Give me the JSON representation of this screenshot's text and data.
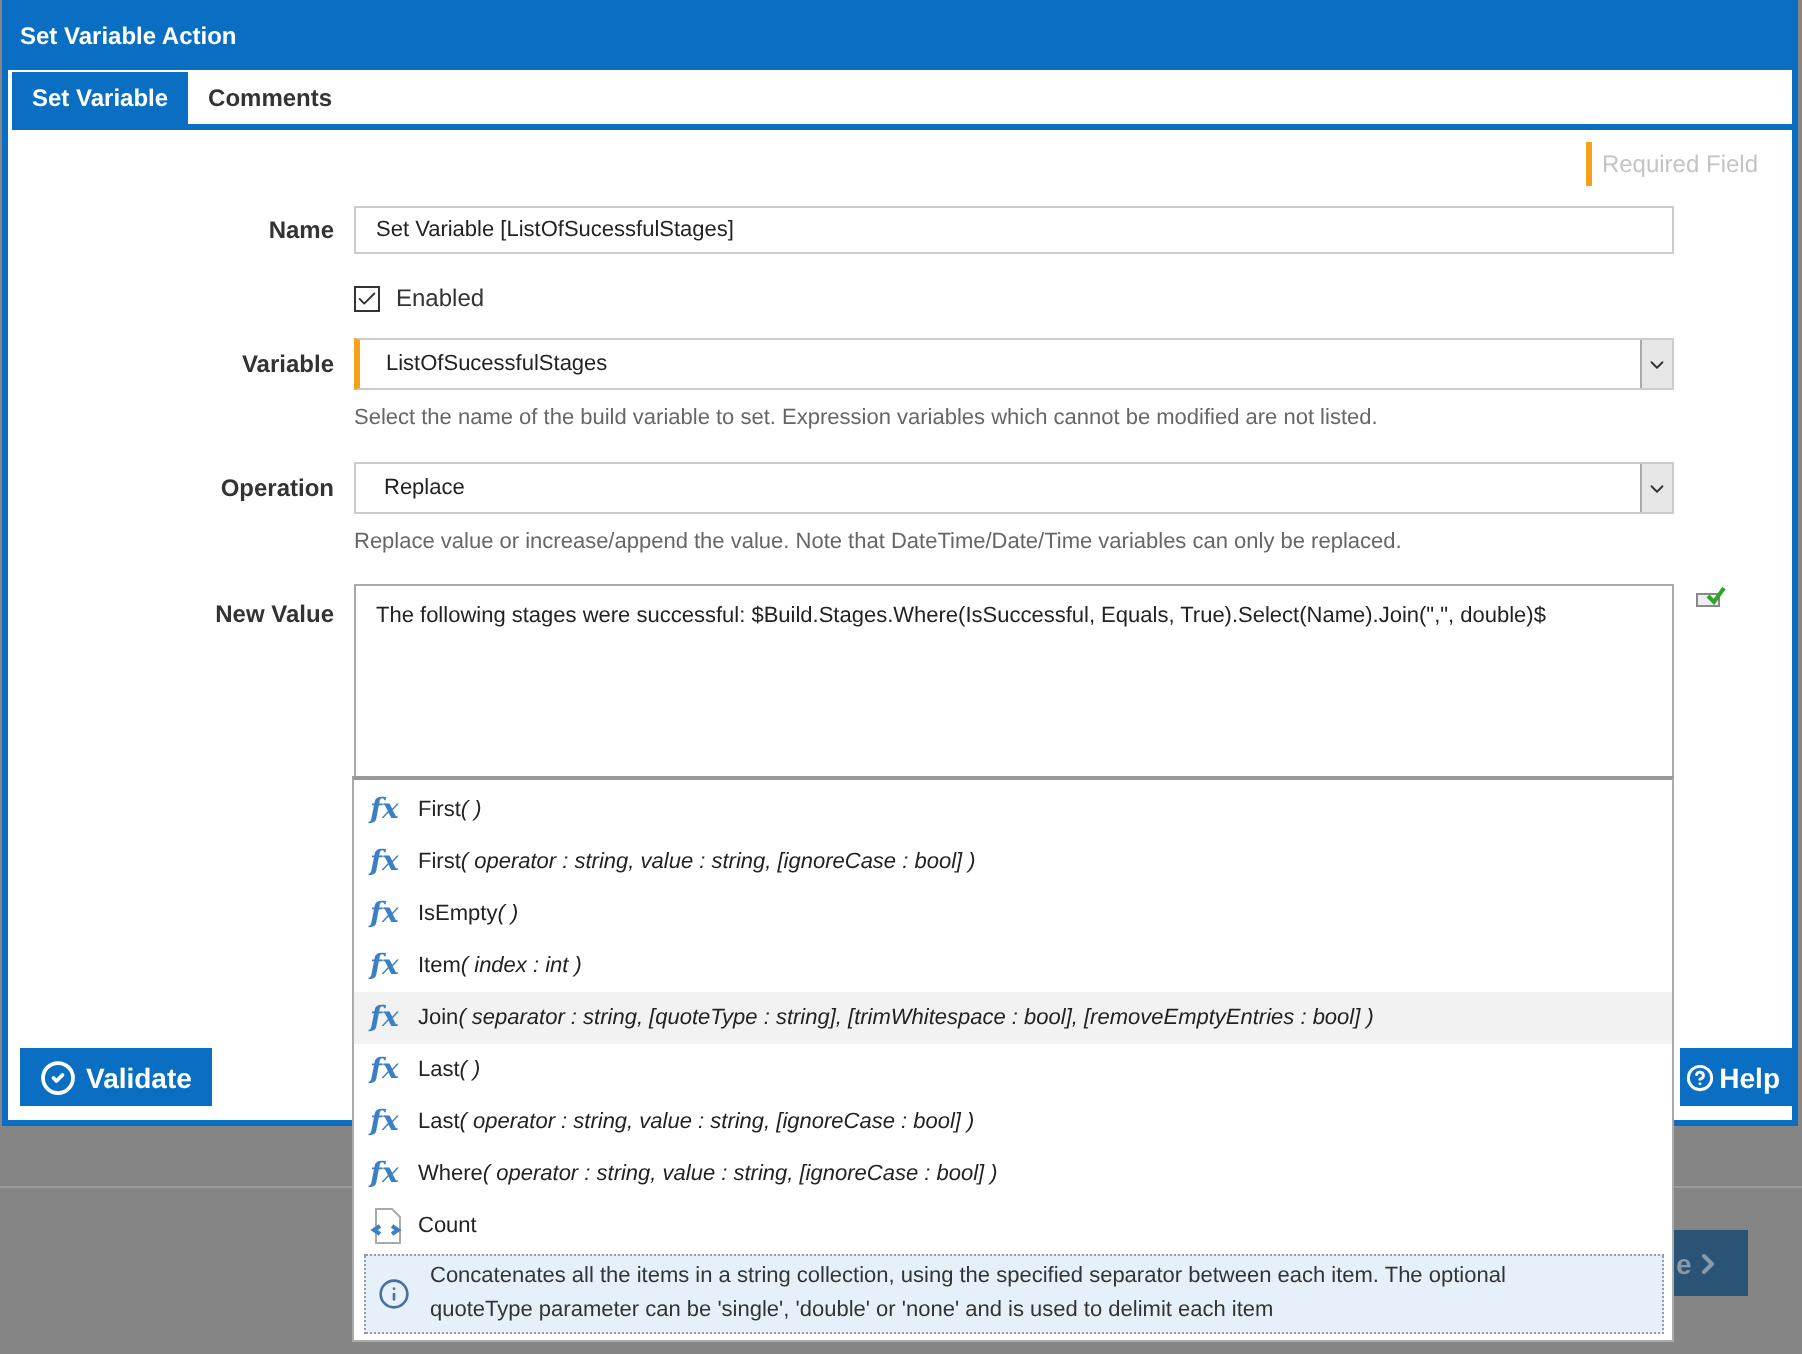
{
  "window": {
    "title": "Set Variable Action"
  },
  "tabs": [
    {
      "label": "Set Variable",
      "selected": true
    },
    {
      "label": "Comments",
      "selected": false
    }
  ],
  "legend": {
    "label": "Required Field"
  },
  "form": {
    "name": {
      "label": "Name",
      "value": "Set Variable [ListOfSucessfulStages]"
    },
    "enabled": {
      "label": "Enabled",
      "checked": true
    },
    "variable": {
      "label": "Variable",
      "value": "ListOfSucessfulStages",
      "required": true,
      "help": "Select the name of the build variable to set. Expression variables which cannot be modified are not listed."
    },
    "operation": {
      "label": "Operation",
      "value": "Replace",
      "required": false,
      "help": "Replace value or increase/append the value. Note that DateTime/Date/Time variables can only be replaced."
    },
    "new_value": {
      "label": "New Value",
      "value": "The following stages were successful: $Build.Stages.Where(IsSuccessful, Equals, True).Select(Name).Join(\",\", double)$"
    }
  },
  "autocomplete": {
    "items": [
      {
        "kind": "function",
        "icon": "fx",
        "name": "First",
        "signature": "( )",
        "selected": false
      },
      {
        "kind": "function",
        "icon": "fx",
        "name": "First",
        "signature": "( operator : string, value : string, [ignoreCase : bool] )",
        "selected": false
      },
      {
        "kind": "function",
        "icon": "fx",
        "name": "IsEmpty",
        "signature": "( )",
        "selected": false
      },
      {
        "kind": "function",
        "icon": "fx",
        "name": "Item",
        "signature": "( index : int )",
        "selected": false
      },
      {
        "kind": "function",
        "icon": "fx",
        "name": "Join",
        "signature": "( separator : string, [quoteType : string], [trimWhitespace : bool], [removeEmptyEntries : bool] )",
        "selected": true
      },
      {
        "kind": "function",
        "icon": "fx",
        "name": "Last",
        "signature": "( )",
        "selected": false
      },
      {
        "kind": "function",
        "icon": "fx",
        "name": "Last",
        "signature": "( operator : string, value : string, [ignoreCase : bool] )",
        "selected": false
      },
      {
        "kind": "function",
        "icon": "fx",
        "name": "Where",
        "signature": "( operator : string, value : string, [ignoreCase : bool] )",
        "selected": false
      },
      {
        "kind": "property",
        "name": "Count",
        "selected": false
      }
    ],
    "info": "Concatenates all the items in a string collection, using the specified separator between each item. The optional quoteType parameter can be 'single', 'double' or 'none' and is used to delimit each item"
  },
  "buttons": [
    {
      "kind": "validate",
      "label": "Validate"
    },
    {
      "kind": "help",
      "label": "Help"
    }
  ],
  "background_page": {
    "button": "e"
  }
}
